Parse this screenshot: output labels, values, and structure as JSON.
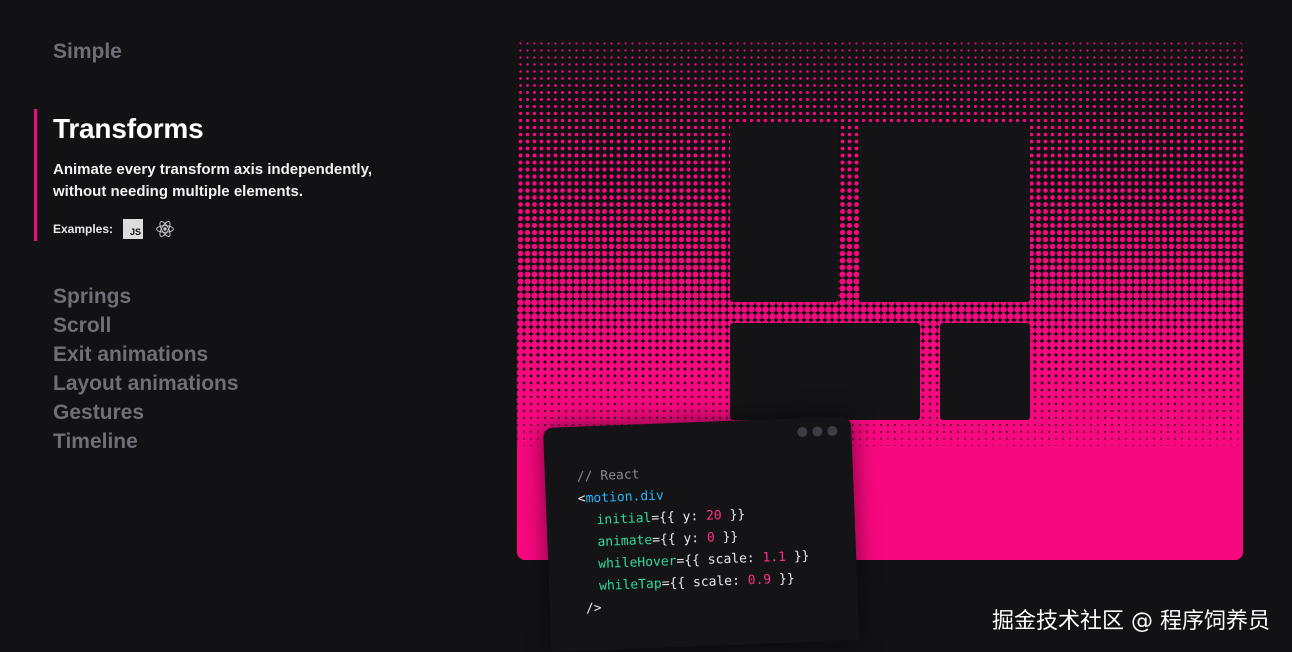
{
  "nav": {
    "top_item": "Simple",
    "active": {
      "title": "Transforms",
      "description": "Animate every transform axis independently, without needing multiple elements.",
      "examples_label": "Examples:",
      "js_badge": "JS",
      "icons": [
        "js-icon",
        "react-icon"
      ]
    },
    "items": [
      "Springs",
      "Scroll",
      "Exit animations",
      "Layout animations",
      "Gestures",
      "Timeline"
    ]
  },
  "demo": {
    "accent_color": "#f8087f",
    "background_color": "#121215"
  },
  "code": {
    "comment": "// React",
    "tag_open": "<",
    "tag_name": "motion.div",
    "line1_attr": "initial",
    "line1_pre": "={{ y: ",
    "line1_num": "20",
    "line1_post": " }}",
    "line2_attr": "animate",
    "line2_pre": "={{ y: ",
    "line2_num": "0",
    "line2_post": " }}",
    "line3_attr": "whileHover",
    "line3_pre": "={{ scale: ",
    "line3_num": "1.1",
    "line3_post": " }}",
    "line4_attr": "whileTap",
    "line4_pre": "={{ scale: ",
    "line4_num": "0.9",
    "line4_post": " }}",
    "tag_close": "/>"
  },
  "watermark": "掘金技术社区 @ 程序饲养员"
}
